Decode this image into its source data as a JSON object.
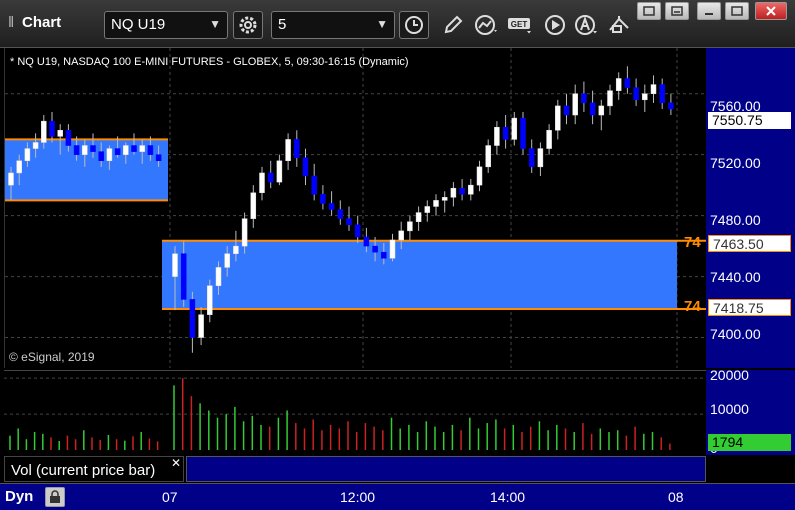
{
  "window": {
    "title": "Chart",
    "grip_icon": "grip-icon"
  },
  "toolbar": {
    "symbol": "NQ U19",
    "interval": "5",
    "icons": [
      "settings-gear-icon",
      "clock-icon",
      "pencil-icon",
      "line-chart-icon",
      "get-icon",
      "play-icon",
      "alert-icon",
      "arrows-icon"
    ],
    "get_label": "GET"
  },
  "window_controls": [
    "restore-icon",
    "minimize-icon",
    "maximize-icon",
    "close-icon"
  ],
  "chart": {
    "header": "* NQ U19, NASDAQ 100 E-MINI FUTURES - GLOBEX, 5, 09:30-16:15 (Dynamic)",
    "copyright": "© eSignal, 2019",
    "price_ticks": [
      "7560.00",
      "7520.00",
      "7480.00",
      "7440.00",
      "7400.00"
    ],
    "current_price": "7550.75",
    "level_high": {
      "marker": "74",
      "price": "7463.50"
    },
    "level_low": {
      "marker": "74",
      "price": "7418.75"
    },
    "colors": {
      "up": "#ffffff",
      "down": "#0000ff",
      "band": "#3377ff",
      "level": "#ff8c00",
      "axis_bg": "#000088"
    }
  },
  "chart_data": {
    "type": "candlestick",
    "symbol": "NQ U19",
    "ylim": [
      7380,
      7590
    ],
    "prev_day_band": {
      "high": 7530,
      "low": 7490
    },
    "today_band": {
      "high": 7463.5,
      "low": 7418.75
    },
    "candles": [
      [
        7500,
        7512,
        7490,
        7508
      ],
      [
        7508,
        7520,
        7500,
        7516
      ],
      [
        7516,
        7528,
        7512,
        7524
      ],
      [
        7524,
        7534,
        7518,
        7528
      ],
      [
        7528,
        7546,
        7524,
        7542
      ],
      [
        7542,
        7548,
        7528,
        7532
      ],
      [
        7532,
        7540,
        7520,
        7536
      ],
      [
        7536,
        7540,
        7522,
        7526
      ],
      [
        7526,
        7532,
        7516,
        7520
      ],
      [
        7520,
        7530,
        7512,
        7526
      ],
      [
        7526,
        7534,
        7518,
        7522
      ],
      [
        7522,
        7528,
        7512,
        7516
      ],
      [
        7516,
        7526,
        7510,
        7524
      ],
      [
        7524,
        7532,
        7518,
        7520
      ],
      [
        7520,
        7528,
        7514,
        7526
      ],
      [
        7526,
        7534,
        7520,
        7522
      ],
      [
        7522,
        7530,
        7514,
        7526
      ],
      [
        7526,
        7532,
        7516,
        7520
      ],
      [
        7520,
        7526,
        7512,
        7516
      ],
      [
        7440,
        7460,
        7418,
        7455
      ],
      [
        7455,
        7463,
        7420,
        7425
      ],
      [
        7425,
        7430,
        7390,
        7400
      ],
      [
        7400,
        7420,
        7395,
        7415
      ],
      [
        7415,
        7438,
        7410,
        7434
      ],
      [
        7434,
        7450,
        7428,
        7446
      ],
      [
        7446,
        7460,
        7440,
        7455
      ],
      [
        7455,
        7470,
        7450,
        7460
      ],
      [
        7460,
        7482,
        7455,
        7478
      ],
      [
        7478,
        7500,
        7472,
        7495
      ],
      [
        7495,
        7512,
        7490,
        7508
      ],
      [
        7508,
        7516,
        7498,
        7502
      ],
      [
        7502,
        7520,
        7500,
        7516
      ],
      [
        7516,
        7534,
        7510,
        7530
      ],
      [
        7530,
        7536,
        7512,
        7518
      ],
      [
        7518,
        7524,
        7500,
        7506
      ],
      [
        7506,
        7514,
        7490,
        7494
      ],
      [
        7494,
        7500,
        7484,
        7488
      ],
      [
        7488,
        7496,
        7480,
        7484
      ],
      [
        7484,
        7490,
        7474,
        7478
      ],
      [
        7478,
        7486,
        7470,
        7474
      ],
      [
        7474,
        7480,
        7462,
        7466
      ],
      [
        7466,
        7472,
        7456,
        7460
      ],
      [
        7460,
        7466,
        7450,
        7456
      ],
      [
        7456,
        7462,
        7448,
        7452
      ],
      [
        7452,
        7468,
        7450,
        7464
      ],
      [
        7464,
        7476,
        7458,
        7470
      ],
      [
        7470,
        7480,
        7464,
        7476
      ],
      [
        7476,
        7486,
        7470,
        7482
      ],
      [
        7482,
        7490,
        7476,
        7486
      ],
      [
        7486,
        7494,
        7480,
        7490
      ],
      [
        7490,
        7496,
        7482,
        7492
      ],
      [
        7492,
        7502,
        7486,
        7498
      ],
      [
        7498,
        7504,
        7490,
        7494
      ],
      [
        7494,
        7504,
        7490,
        7500
      ],
      [
        7500,
        7516,
        7496,
        7512
      ],
      [
        7512,
        7530,
        7508,
        7526
      ],
      [
        7526,
        7542,
        7520,
        7538
      ],
      [
        7538,
        7546,
        7524,
        7530
      ],
      [
        7530,
        7548,
        7526,
        7544
      ],
      [
        7544,
        7548,
        7520,
        7524
      ],
      [
        7524,
        7530,
        7508,
        7512
      ],
      [
        7512,
        7528,
        7506,
        7524
      ],
      [
        7524,
        7540,
        7520,
        7536
      ],
      [
        7536,
        7556,
        7530,
        7552
      ],
      [
        7552,
        7560,
        7540,
        7546
      ],
      [
        7546,
        7566,
        7540,
        7560
      ],
      [
        7560,
        7568,
        7548,
        7554
      ],
      [
        7554,
        7562,
        7540,
        7546
      ],
      [
        7546,
        7556,
        7536,
        7552
      ],
      [
        7552,
        7566,
        7546,
        7562
      ],
      [
        7562,
        7574,
        7556,
        7570
      ],
      [
        7570,
        7578,
        7560,
        7564
      ],
      [
        7564,
        7570,
        7552,
        7556
      ],
      [
        7556,
        7566,
        7548,
        7560
      ],
      [
        7560,
        7572,
        7554,
        7566
      ],
      [
        7566,
        7570,
        7550,
        7554
      ],
      [
        7554,
        7560,
        7546,
        7550
      ]
    ],
    "volume": {
      "ylim": [
        0,
        22000
      ],
      "ticks": [
        "20000",
        "10000",
        "0"
      ],
      "current": "1794",
      "values": [
        4000,
        6000,
        3000,
        5000,
        4500,
        3500,
        2500,
        4000,
        3000,
        5500,
        3500,
        2800,
        4200,
        3000,
        2600,
        3800,
        5000,
        3200,
        2400,
        18000,
        20000,
        15000,
        13000,
        11000,
        9000,
        10000,
        12000,
        8000,
        9500,
        7000,
        6500,
        9000,
        11000,
        7500,
        6000,
        8500,
        5500,
        7000,
        6000,
        8000,
        5000,
        7500,
        6500,
        5500,
        9000,
        6000,
        7000,
        5000,
        8000,
        6500,
        5000,
        7000,
        5500,
        9000,
        6000,
        7500,
        8500,
        6000,
        7000,
        5000,
        6500,
        8000,
        5500,
        7000,
        6000,
        5000,
        7500,
        4500,
        6000,
        5000,
        5500,
        4000,
        6500,
        4500,
        5000,
        3500,
        1794
      ],
      "colors": {
        "up": "#33cc33",
        "down": "#cc2222"
      }
    }
  },
  "volume_panel": {
    "legend": "Vol (current price bar)",
    "close_icon": "close-icon"
  },
  "time_axis": {
    "mode_label": "Dyn",
    "lock_icon": "lock-icon",
    "ticks": [
      "07",
      "12:00",
      "14:00",
      "08"
    ]
  }
}
